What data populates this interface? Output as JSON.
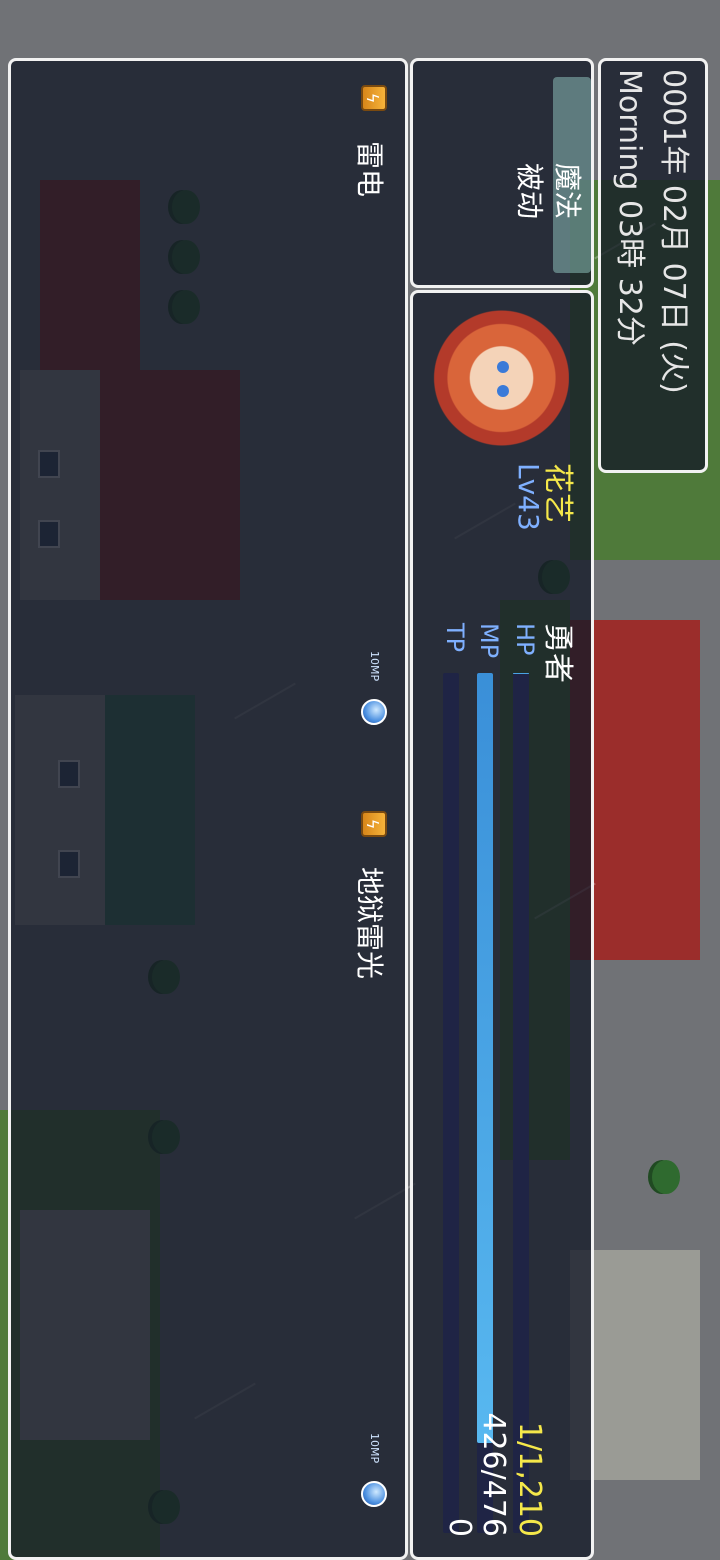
{
  "datetime": {
    "line1": "0001年 02月 07日 (火)",
    "line2": "Morning 03時 32分"
  },
  "command_menu": {
    "items": [
      {
        "label": "魔法"
      },
      {
        "label": "被动"
      }
    ]
  },
  "actor": {
    "name": "花艺",
    "class": "勇者",
    "level": "Lv43",
    "hp_label": "HP",
    "mp_label": "MP",
    "tp_label": "TP",
    "hp_value": "1/1,210",
    "mp_value": "426/476",
    "tp_value": "0",
    "hp_ratio": 0.001,
    "mp_ratio": 0.895,
    "tp_ratio": 0
  },
  "skills": [
    {
      "name": "雷电",
      "icon": "lightning-icon",
      "cost": "10MP"
    },
    {
      "name": "地狱雷光",
      "icon": "lightning-icon",
      "cost": "10MP"
    }
  ],
  "colors": {
    "name": "#f5e84a",
    "level": "#7fb0ff",
    "stat_label": "#7fb0ff"
  }
}
